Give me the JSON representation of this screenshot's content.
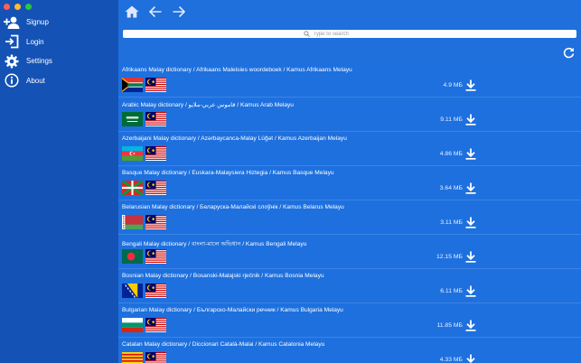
{
  "window": {
    "controls": [
      "close",
      "minimize",
      "zoom"
    ],
    "control_colors": [
      "#fe5f57",
      "#febc2e",
      "#28c840"
    ]
  },
  "sidebar": {
    "items": [
      {
        "label": "Signup",
        "icon": "add-user-icon"
      },
      {
        "label": "Login",
        "icon": "login-icon"
      },
      {
        "label": "Settings",
        "icon": "gear-icon"
      },
      {
        "label": "About",
        "icon": "info-icon"
      }
    ]
  },
  "toolbar": {
    "icons": [
      "home-icon",
      "back-arrow-icon",
      "forward-arrow-icon"
    ]
  },
  "search": {
    "placeholder": "Type to search",
    "value": ""
  },
  "refresh": {
    "icon": "refresh-icon"
  },
  "colors": {
    "sidebar": "#1452b5",
    "main": "#1f6fdc",
    "row_divider": "#3c84e4"
  },
  "dictionaries": [
    {
      "title": "Afrikaans Malay dictionary / Afrikaans Maleisies woordeboek / Kamus Afrikaans Melayu",
      "size": "4.9 MБ",
      "flag": "south-africa"
    },
    {
      "title": "Arabic Malay dictionary / قاموس عربي-ملايو / Kamus Arab Melayu",
      "size": "9.11 MБ",
      "flag": "saudi-arabia"
    },
    {
      "title": "Azerbaijani Malay dictionary / Azərbaycanca-Malay Lüğət / Kamus Azerbaijan Melayu",
      "size": "4.86 MБ",
      "flag": "azerbaijan"
    },
    {
      "title": "Basque Malay dictionary / Euskara-Malaysiera Hiztegia / Kamus Basque Melayu",
      "size": "3.64 MБ",
      "flag": "basque"
    },
    {
      "title": "Belarusian Malay dictionary / Беларуска-Малайскі слоўнік / Kamus Belarus Melayu",
      "size": "3.11 MБ",
      "flag": "belarus"
    },
    {
      "title": "Bengali Malay dictionary / বাংলা-মালে অভিধান / Kamus Bengali Melayu",
      "size": "12.15 MБ",
      "flag": "bangladesh"
    },
    {
      "title": "Bosnian Malay dictionary / Bosanski-Malajski rječnik / Kamus Bosnia Melayu",
      "size": "6.11 MБ",
      "flag": "bosnia"
    },
    {
      "title": "Bulgarian Malay dictionary / Българско-Малайски речник / Kamus Bulgaria Melayu",
      "size": "11.85 MБ",
      "flag": "bulgaria"
    },
    {
      "title": "Catalan Malay dictionary / Diccionari Català-Malai / Kamus Catalonia Melayu",
      "size": "4.33 MБ",
      "flag": "catalonia"
    }
  ]
}
